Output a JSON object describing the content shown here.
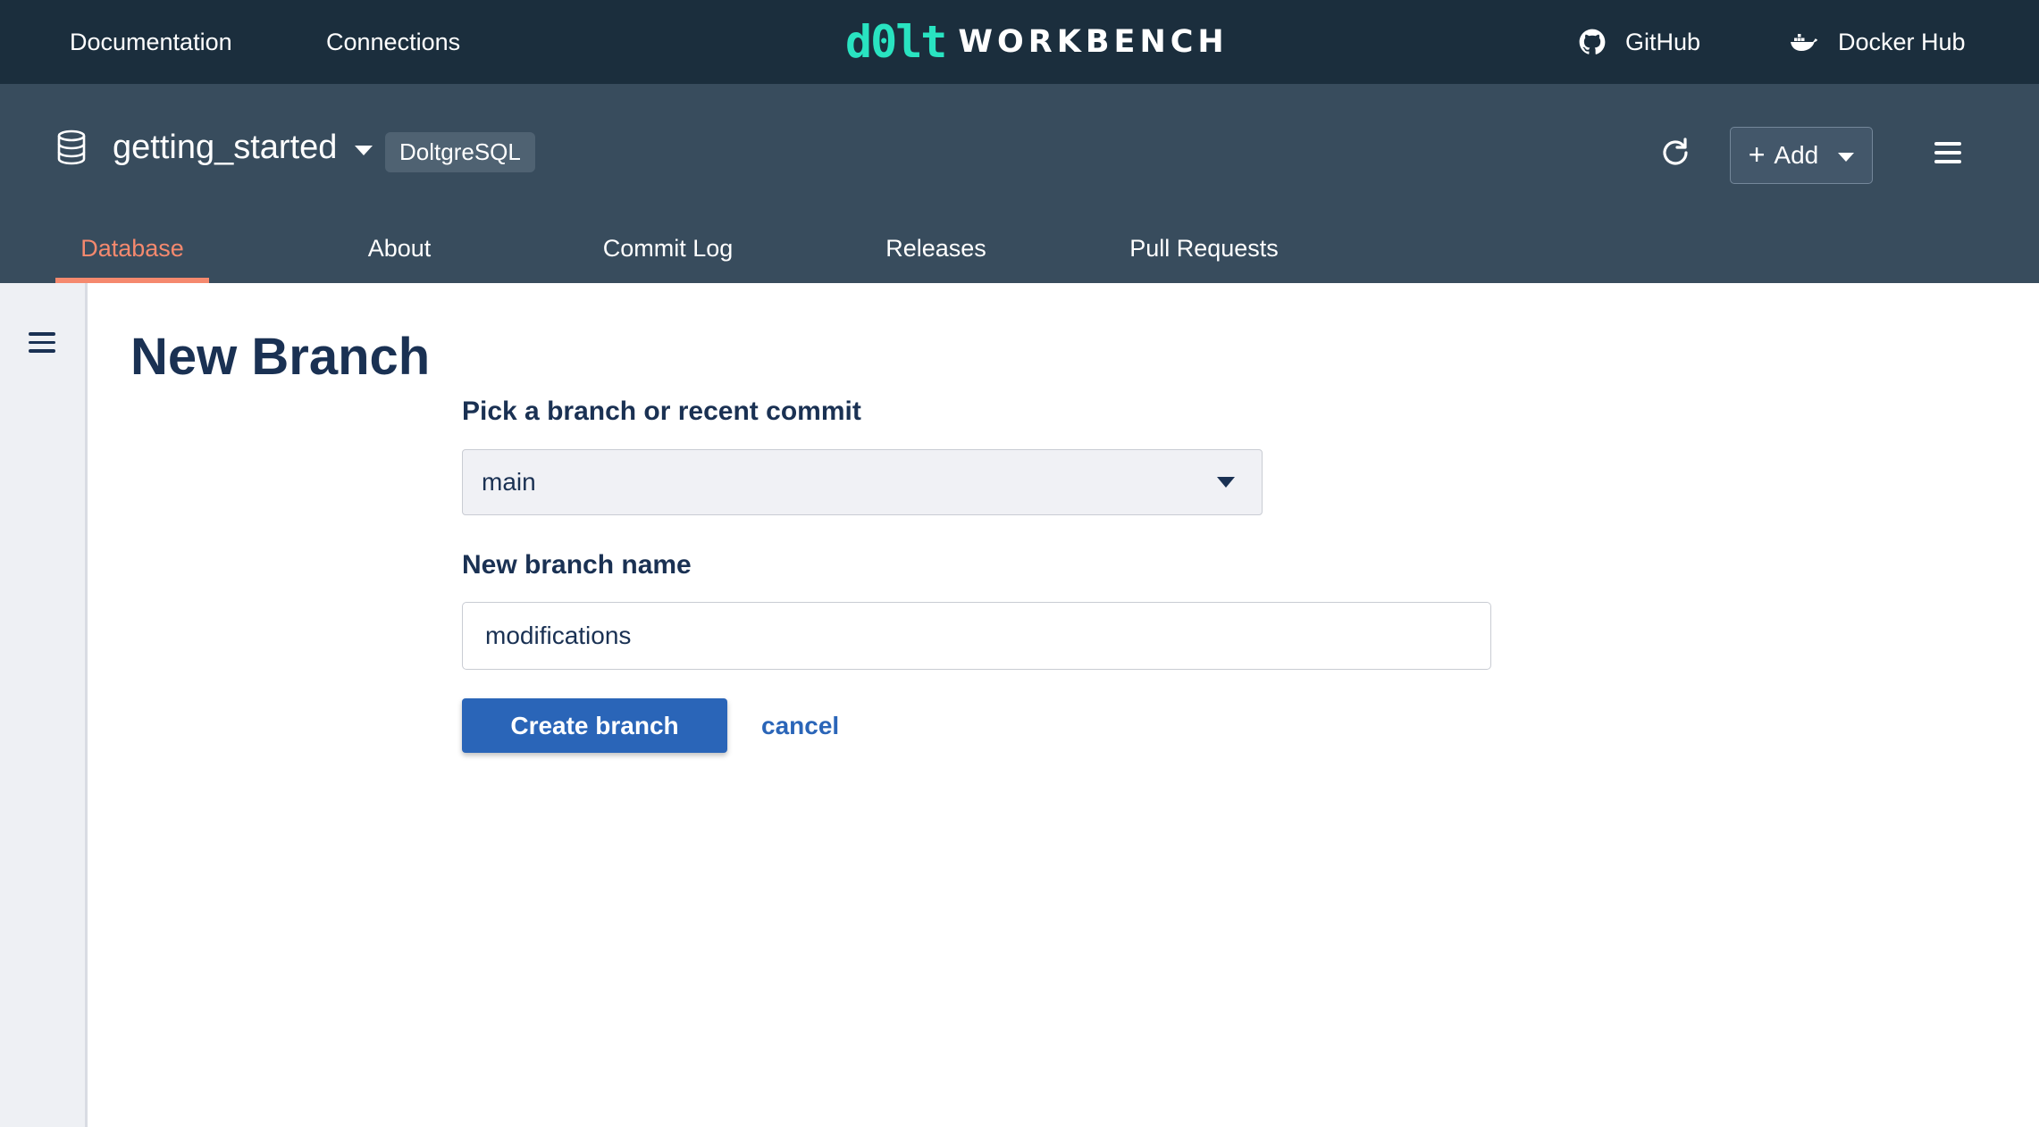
{
  "topnav": {
    "links": [
      {
        "label": "Documentation"
      },
      {
        "label": "Connections"
      }
    ],
    "logo": {
      "mark": "d0lt",
      "text": "WORKBENCH"
    },
    "external": [
      {
        "label": "GitHub",
        "icon": "github-icon"
      },
      {
        "label": "Docker Hub",
        "icon": "docker-icon"
      }
    ]
  },
  "database": {
    "name": "getting_started",
    "dialect": "DoltgreSQL",
    "add_label": "Add"
  },
  "tabs": [
    {
      "label": "Database",
      "active": true
    },
    {
      "label": "About",
      "active": false
    },
    {
      "label": "Commit Log",
      "active": false
    },
    {
      "label": "Releases",
      "active": false
    },
    {
      "label": "Pull Requests",
      "active": false
    }
  ],
  "form": {
    "title": "New Branch",
    "from_label": "Pick a branch or recent commit",
    "from_value": "main",
    "name_label": "New branch name",
    "name_value": "modifications",
    "submit_label": "Create branch",
    "cancel_label": "cancel"
  },
  "colors": {
    "topnav_bg": "#1b2e3d",
    "header_bg": "#384c5d",
    "accent": "#f5896e",
    "primary": "#2a65b8",
    "logo": "#29e3c1",
    "text": "#1a3153"
  }
}
